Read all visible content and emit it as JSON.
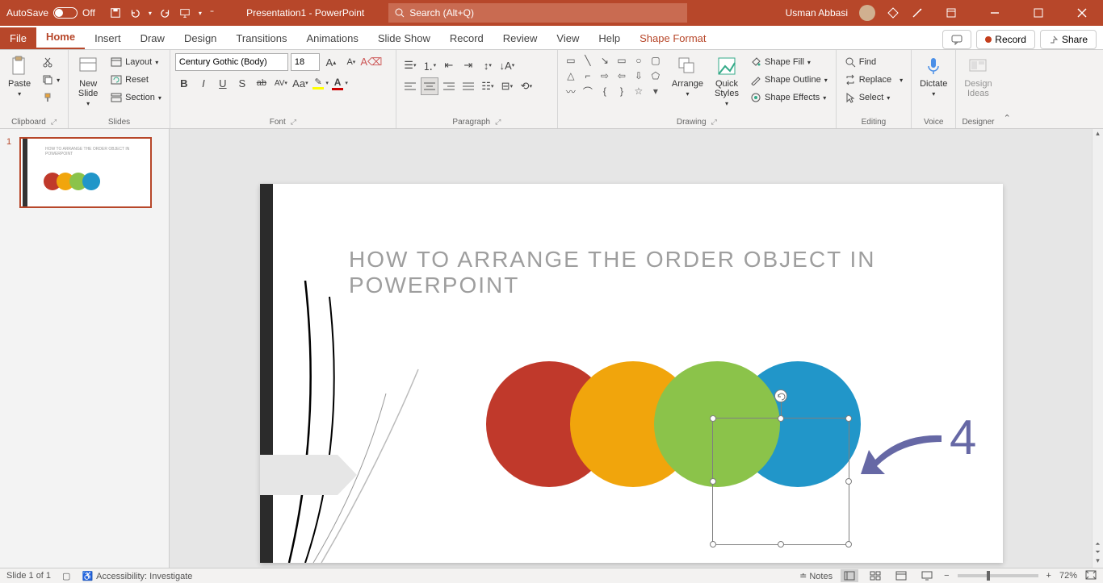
{
  "titlebar": {
    "autosave": "AutoSave",
    "autosave_state": "Off",
    "doc_title": "Presentation1 - PowerPoint",
    "search_placeholder": "Search (Alt+Q)",
    "user": "Usman Abbasi"
  },
  "tabs": {
    "file": "File",
    "list": [
      "Home",
      "Insert",
      "Draw",
      "Design",
      "Transitions",
      "Animations",
      "Slide Show",
      "Record",
      "Review",
      "View",
      "Help"
    ],
    "active": "Home",
    "context": "Shape Format",
    "record": "Record",
    "share": "Share"
  },
  "ribbon": {
    "clipboard": {
      "paste": "Paste",
      "label": "Clipboard"
    },
    "slides": {
      "new_slide": "New\nSlide",
      "layout": "Layout",
      "reset": "Reset",
      "section": "Section",
      "label": "Slides"
    },
    "font": {
      "name": "Century Gothic (Body)",
      "size": "18",
      "label": "Font"
    },
    "paragraph": {
      "label": "Paragraph"
    },
    "drawing": {
      "arrange": "Arrange",
      "quick_styles": "Quick\nStyles",
      "shape_fill": "Shape Fill",
      "shape_outline": "Shape Outline",
      "shape_effects": "Shape Effects",
      "label": "Drawing"
    },
    "editing": {
      "find": "Find",
      "replace": "Replace",
      "select": "Select",
      "label": "Editing"
    },
    "voice": {
      "dictate": "Dictate",
      "label": "Voice"
    },
    "designer": {
      "design_ideas": "Design\nIdeas",
      "label": "Designer"
    }
  },
  "thumb": {
    "num": "1",
    "title": "HOW TO ARRANGE THE ORDER OBJECT IN POWERPOINT"
  },
  "slide": {
    "title": "HOW TO ARRANGE THE ORDER  OBJECT  IN POWERPOINT",
    "label_4": "4",
    "colors": {
      "red": "#c0392b",
      "yellow": "#f1a50c",
      "green": "#8bc34a",
      "blue": "#2196c9"
    }
  },
  "status": {
    "slide_info": "Slide 1 of 1",
    "accessibility": "Accessibility: Investigate",
    "notes": "Notes",
    "zoom": "72%"
  }
}
